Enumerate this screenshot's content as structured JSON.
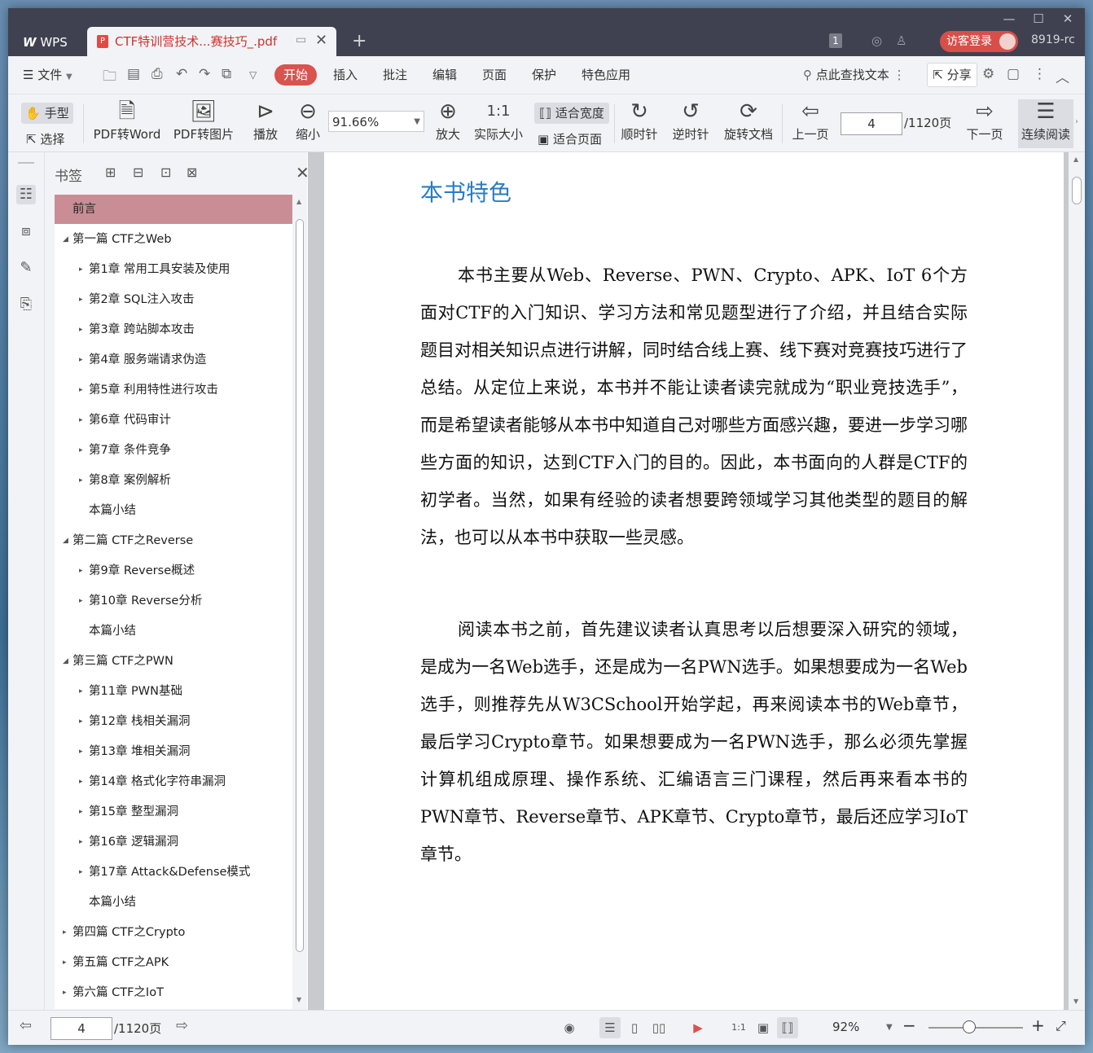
{
  "titlebar": {
    "app_tab": "WPS",
    "doc_tab_title": "CTF特训营技术...赛技巧_.pdf",
    "doc_badge": "1",
    "login_button": "访客登录",
    "user_id": "8919-rc"
  },
  "menubar": {
    "file": "文件",
    "items": [
      "开始",
      "插入",
      "批注",
      "编辑",
      "页面",
      "保护",
      "特色应用"
    ],
    "search": "点此查找文本",
    "share": "分享"
  },
  "toolbar": {
    "hand": "手型",
    "select": "选择",
    "pdf_to_word": "PDF转Word",
    "pdf_to_image": "PDF转图片",
    "play": "播放",
    "zoom_out": "缩小",
    "zoom_value": "91.66%",
    "zoom_in": "放大",
    "actual_size": "实际大小",
    "fit_width": "适合宽度",
    "fit_page": "适合页面",
    "clockwise": "顺时针",
    "counter_clockwise": "逆时针",
    "rotate_doc": "旋转文档",
    "prev_page": "上一页",
    "current_page": "4",
    "total_pages": "/1120页",
    "next_page": "下一页",
    "continuous": "连续阅读"
  },
  "bookmark": {
    "title": "书签",
    "items": [
      {
        "label": "前言",
        "level": 0,
        "arrow": "",
        "selected": true
      },
      {
        "label": "第一篇 CTF之Web",
        "level": 0,
        "arrow": "◢"
      },
      {
        "label": "第1章 常用工具安装及使用",
        "level": 1,
        "arrow": "▸"
      },
      {
        "label": "第2章 SQL注入攻击",
        "level": 1,
        "arrow": "▸"
      },
      {
        "label": "第3章 跨站脚本攻击",
        "level": 1,
        "arrow": "▸"
      },
      {
        "label": "第4章 服务端请求伪造",
        "level": 1,
        "arrow": "▸"
      },
      {
        "label": "第5章 利用特性进行攻击",
        "level": 1,
        "arrow": "▸"
      },
      {
        "label": "第6章 代码审计",
        "level": 1,
        "arrow": "▸"
      },
      {
        "label": "第7章 条件竞争",
        "level": 1,
        "arrow": "▸"
      },
      {
        "label": "第8章 案例解析",
        "level": 1,
        "arrow": "▸"
      },
      {
        "label": "本篇小结",
        "level": 1,
        "arrow": ""
      },
      {
        "label": "第二篇 CTF之Reverse",
        "level": 0,
        "arrow": "◢"
      },
      {
        "label": "第9章 Reverse概述",
        "level": 1,
        "arrow": "▸"
      },
      {
        "label": "第10章 Reverse分析",
        "level": 1,
        "arrow": "▸"
      },
      {
        "label": "本篇小结",
        "level": 1,
        "arrow": ""
      },
      {
        "label": "第三篇 CTF之PWN",
        "level": 0,
        "arrow": "◢"
      },
      {
        "label": "第11章 PWN基础",
        "level": 1,
        "arrow": "▸"
      },
      {
        "label": "第12章 栈相关漏洞",
        "level": 1,
        "arrow": "▸"
      },
      {
        "label": "第13章 堆相关漏洞",
        "level": 1,
        "arrow": "▸"
      },
      {
        "label": "第14章 格式化字符串漏洞",
        "level": 1,
        "arrow": "▸"
      },
      {
        "label": "第15章 整型漏洞",
        "level": 1,
        "arrow": "▸"
      },
      {
        "label": "第16章 逻辑漏洞",
        "level": 1,
        "arrow": "▸"
      },
      {
        "label": "第17章 Attack&Defense模式",
        "level": 1,
        "arrow": "▸"
      },
      {
        "label": "本篇小结",
        "level": 1,
        "arrow": ""
      },
      {
        "label": "第四篇 CTF之Crypto",
        "level": 0,
        "arrow": "▸"
      },
      {
        "label": "第五篇 CTF之APK",
        "level": 0,
        "arrow": "▸"
      },
      {
        "label": "第六篇 CTF之IoT",
        "level": 0,
        "arrow": "▸"
      }
    ]
  },
  "document": {
    "heading": "本书特色",
    "paragraphs": [
      "本书主要从Web、Reverse、PWN、Crypto、APK、IoT 6个方面对CTF的入门知识、学习方法和常见题型进行了介绍，并且结合实际题目对相关知识点进行讲解，同时结合线上赛、线下赛对竞赛技巧进行了总结。从定位上来说，本书并不能让读者读完就成为“职业竞技选手”，而是希望读者能够从本书中知道自己对哪些方面感兴趣，要进一步学习哪些方面的知识，达到CTF入门的目的。因此，本书面向的人群是CTF的初学者。当然，如果有经验的读者想要跨领域学习其他类型的题目的解法，也可以从本书中获取一些灵感。",
      "阅读本书之前，首先建议读者认真思考以后想要深入研究的领域，是成为一名Web选手，还是成为一名PWN选手。如果想要成为一名Web选手，则推荐先从W3CSchool开始学起，再来阅读本书的Web章节，最后学习Crypto章节。如果想要成为一名PWN选手，那么必须先掌握计算机组成原理、操作系统、汇编语言三门课程，然后再来看本书的PWN章节、Reverse章节、APK章节、Crypto章节，最后还应学习IoT章节。"
    ]
  },
  "statusbar": {
    "current_page": "4",
    "total_pages": "/1120页",
    "zoom": "92%"
  },
  "colors": {
    "accent_red": "#d9534f",
    "heading_blue": "#2a7cc2",
    "selected_bookmark": "#c98e95"
  }
}
